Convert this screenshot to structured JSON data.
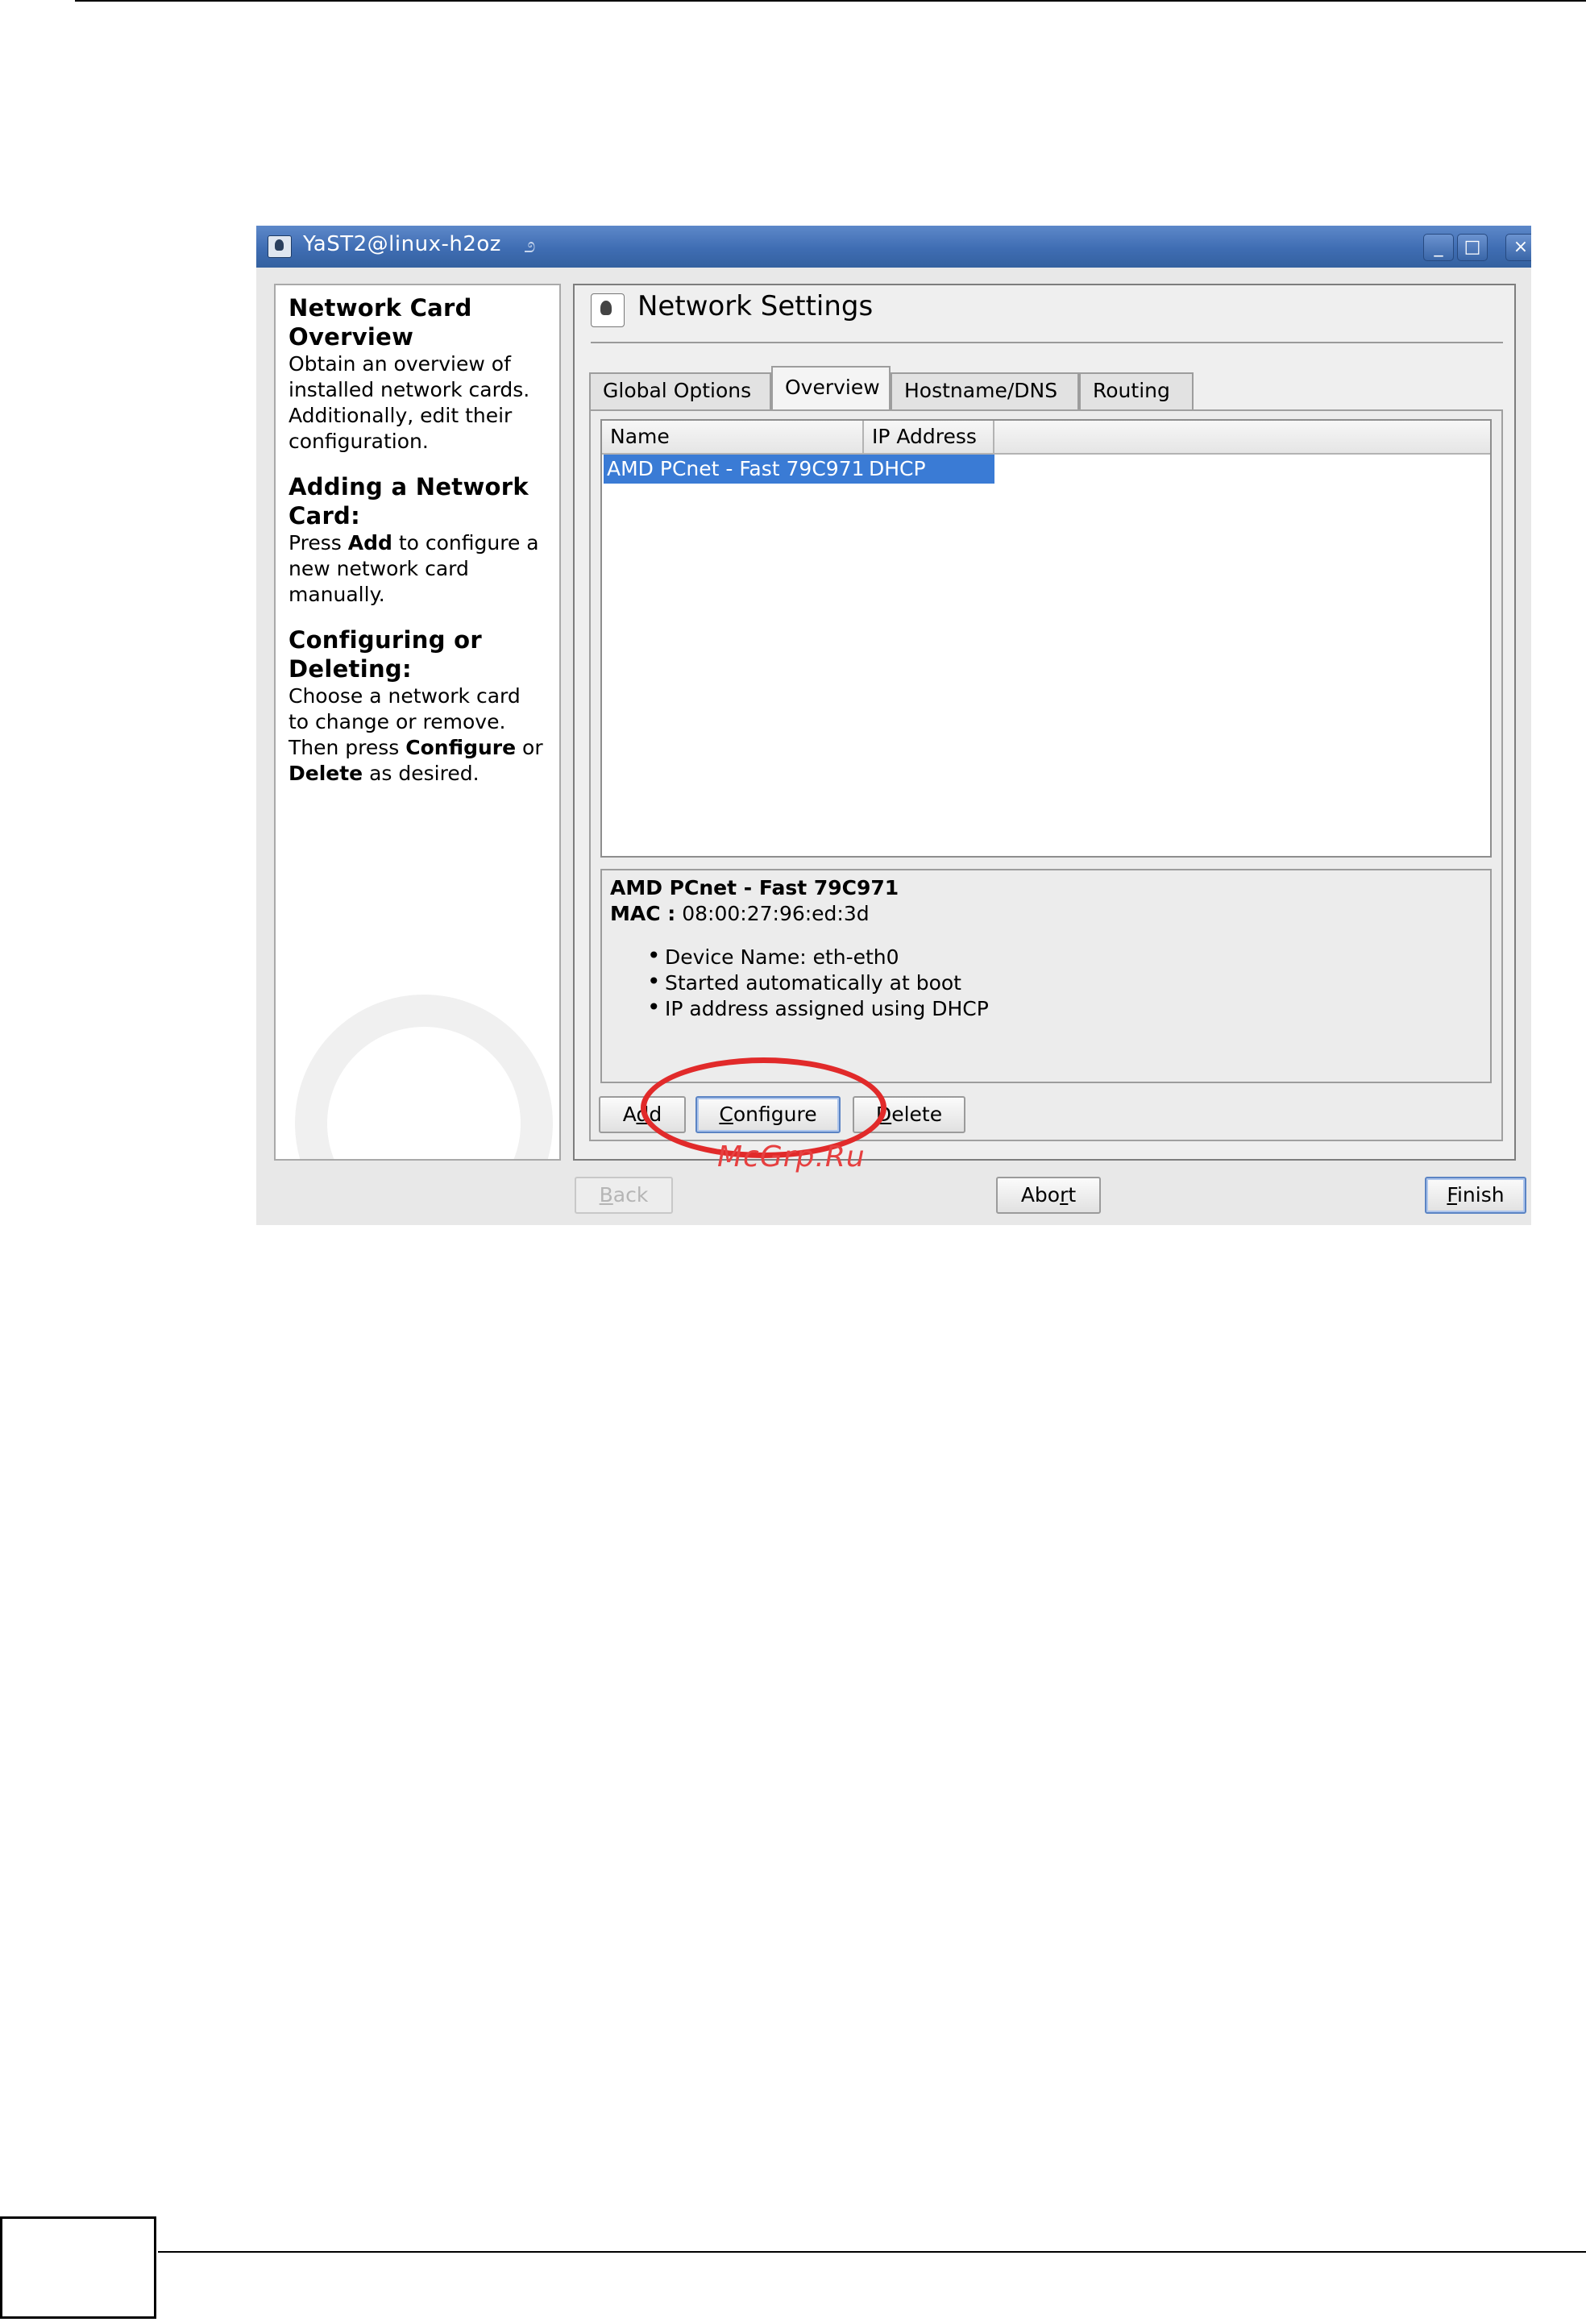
{
  "window": {
    "title": "YaST2@linux-h2oz",
    "controls": {
      "minimize": "_",
      "maximize": "□",
      "close": "×"
    }
  },
  "help": {
    "sections": [
      {
        "heading": "Network Card Overview",
        "text": "Obtain an overview of installed network cards. Additionally, edit their configuration."
      },
      {
        "heading": "Adding a Network Card:",
        "text_before": "Press ",
        "bold": "Add",
        "text_after": " to configure a new network card manually."
      },
      {
        "heading": "Configuring or Deleting:",
        "text_before": "Choose a network card to change or remove. Then press ",
        "bold1": "Configure",
        "text_mid": " or ",
        "bold2": "Delete",
        "text_after": " as desired."
      }
    ]
  },
  "main": {
    "title": "Network Settings",
    "tabs": [
      {
        "label": "Global Options",
        "active": false
      },
      {
        "label": "Overview",
        "active": true
      },
      {
        "label": "Hostname/DNS",
        "active": false
      },
      {
        "label": "Routing",
        "active": false
      }
    ],
    "table": {
      "columns": [
        "Name",
        "IP Address"
      ],
      "rows": [
        {
          "name": "AMD PCnet - Fast 79C971",
          "ip": "DHCP",
          "selected": true
        }
      ]
    },
    "details": {
      "title": "AMD PCnet - Fast 79C971",
      "mac_label": "MAC :",
      "mac_value": "08:00:27:96:ed:3d",
      "bullets": [
        "Device Name: eth-eth0",
        "Started automatically at boot",
        "IP address assigned using DHCP"
      ]
    },
    "buttons": {
      "add": {
        "pre": "A",
        "u": "d",
        "post": "d"
      },
      "configure": {
        "pre": "",
        "u": "C",
        "post": "onfigure"
      },
      "delete": {
        "pre": "",
        "u": "D",
        "post": "elete"
      }
    }
  },
  "footer": {
    "back": {
      "u": "B",
      "post": "ack",
      "enabled": false
    },
    "abort": {
      "pre": "Abo",
      "u": "r",
      "post": "t"
    },
    "finish": {
      "u": "F",
      "post": "inish"
    }
  },
  "annotation": {
    "watermark": "McGrp.Ru",
    "highlight_color": "#e12a2a"
  },
  "colors": {
    "titlebar": "#3f6db3",
    "selection": "#3a7bd5"
  }
}
